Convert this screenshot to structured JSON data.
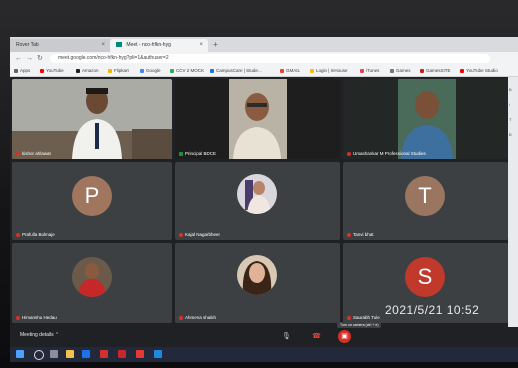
{
  "browser": {
    "tabs": [
      {
        "label": "Rover Tab"
      },
      {
        "label": "Meet - nco-hfkn-hyg"
      }
    ],
    "new_tab": "+",
    "url": "meet.google.com/nco-hfkn-hyg?pli=1&authuser=2",
    "bookmarks": [
      {
        "label": "Apps",
        "color": "#5f6368"
      },
      {
        "label": "YouTube",
        "color": "#ff0000"
      },
      {
        "label": "Amazon",
        "color": "#222222"
      },
      {
        "label": "Flipkart",
        "color": "#f7b500"
      },
      {
        "label": "Google",
        "color": "#4285f4"
      },
      {
        "label": "CCV 2 MOCK",
        "color": "#34a853"
      },
      {
        "label": "CampusCare | Stude...",
        "color": "#1a73e8"
      },
      {
        "label": "GMAIL",
        "color": "#ea4335"
      },
      {
        "label": "Login | InHouse",
        "color": "#fbbc04"
      },
      {
        "label": "iTunes",
        "color": "#e94057"
      },
      {
        "label": "Games",
        "color": "#777777"
      },
      {
        "label": "GamesSITE",
        "color": "#c5221f"
      },
      {
        "label": "YouTube Studio",
        "color": "#ff0000"
      }
    ]
  },
  "participants": [
    {
      "name": "kishor ahlawat",
      "kind": "video"
    },
    {
      "name": "Principal BDCE",
      "kind": "video"
    },
    {
      "name": "Umashankar M Professional Studies",
      "kind": "video"
    },
    {
      "name": "Prafulla Bolmaje",
      "kind": "letter",
      "letter": "P",
      "color": "#a0765f"
    },
    {
      "name": "Kajal Nagarbheer",
      "kind": "photo"
    },
    {
      "name": "Tanvi bhat",
      "kind": "letter",
      "letter": "T",
      "color": "#9a7560"
    },
    {
      "name": "Himanshu Hedau",
      "kind": "photo"
    },
    {
      "name": "Ahmena shaikh",
      "kind": "photo"
    },
    {
      "name": "Saurabh Tule",
      "kind": "letter",
      "letter": "S",
      "color": "#c0392b"
    }
  ],
  "side_panel": [
    "B",
    "i",
    "T",
    "B"
  ],
  "meet_bar": {
    "details_label": "Meeting details",
    "tooltip": "Turn on camera (ctrl + e)"
  },
  "timestamp": "2021/5/21  10:52"
}
